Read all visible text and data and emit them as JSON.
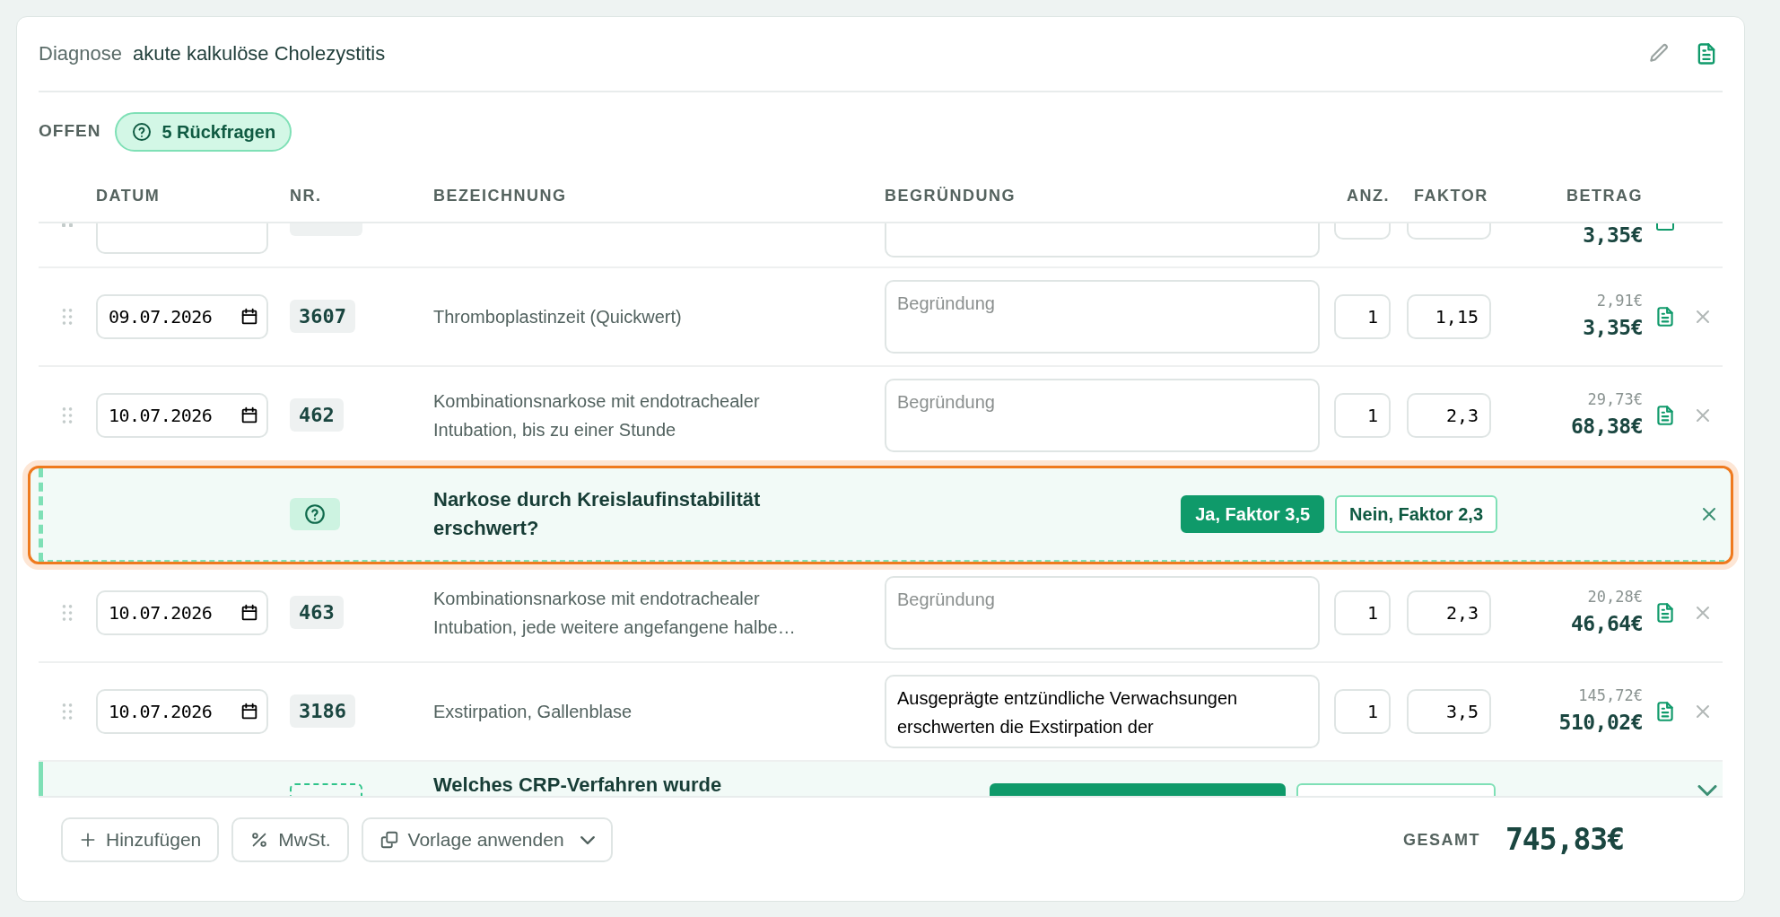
{
  "header": {
    "label": "Diagnose",
    "diagnosis": "akute kalkulöse Cholezystitis"
  },
  "status": {
    "label": "OFFEN",
    "queries": "5 Rückfragen"
  },
  "columns": [
    "DATUM",
    "NR.",
    "BEZEICHNUNG",
    "BEGRÜNDUNG",
    "ANZ.",
    "FAKTOR",
    "BETRAG"
  ],
  "rows": [
    {
      "kind": "partial",
      "amount": "3,35€"
    },
    {
      "kind": "item",
      "date": "09.07.2026",
      "code": "3607",
      "description": "Thromboplastinzeit (Quickwert)",
      "reason": {
        "placeholder": "Begründung"
      },
      "quantity": "1",
      "factor": "1,15",
      "base": "2,91€",
      "amount": "3,35€"
    },
    {
      "kind": "item",
      "date": "10.07.2026",
      "code": "462",
      "description": "Kombinationsnarkose mit endotrachealer Intubation, bis zu einer Stunde",
      "reason": {
        "placeholder": "Begründung"
      },
      "quantity": "1",
      "factor": "2,3",
      "base": "29,73€",
      "amount": "68,38€"
    },
    {
      "kind": "question",
      "focused": true,
      "question": "Narkose durch Kreislaufinstabilität erschwert?",
      "answers": [
        {
          "label": "Ja, Faktor 3,5",
          "selected": true
        },
        {
          "label": "Nein, Faktor 2,3",
          "selected": false
        }
      ],
      "dismissible": true
    },
    {
      "kind": "item",
      "date": "10.07.2026",
      "code": "463",
      "description": "Kombinationsnarkose mit endotrachealer Intubation, jede weitere angefangene halbe…",
      "reason": {
        "placeholder": "Begründung"
      },
      "quantity": "1",
      "factor": "2,3",
      "base": "20,28€",
      "amount": "46,64€"
    },
    {
      "kind": "item",
      "date": "10.07.2026",
      "code": "3186",
      "description": "Exstirpation, Gallenblase",
      "reason": {
        "value": "Ausgeprägte entzündliche Verwachsungen erschwerten die Exstirpation der"
      },
      "quantity": "1",
      "factor": "3,5",
      "base": "145,72€",
      "amount": "510,02€"
    },
    {
      "kind": "question",
      "focused": false,
      "question": "Welches CRP-Verfahren wurde",
      "answers": [
        {
          "selected": true
        },
        {
          "selected": false
        }
      ],
      "dismissible": false
    }
  ],
  "footer": {
    "buttons": [
      {
        "kind": "add",
        "label": "Hinzufügen"
      },
      {
        "kind": "percent",
        "label": "MwSt."
      },
      {
        "kind": "template",
        "label": "Vorlage anwenden",
        "dropdown": true
      }
    ],
    "total_label": "GESAMT",
    "total": "745,83€"
  }
}
